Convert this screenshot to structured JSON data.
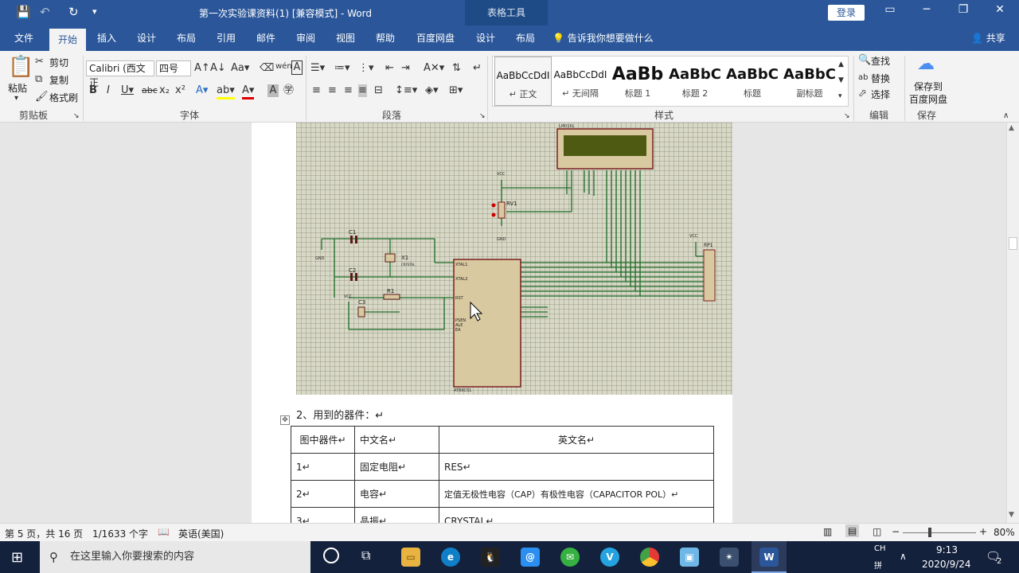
{
  "titlebar": {
    "doc_title": "第一次实验课资料(1) [兼容模式]  -  Word",
    "context_tool": "表格工具",
    "login_label": "登录"
  },
  "tabs": [
    "文件",
    "开始",
    "插入",
    "设计",
    "布局",
    "引用",
    "邮件",
    "审阅",
    "视图",
    "帮助",
    "百度网盘",
    "设计",
    "布局"
  ],
  "tell_me": "告诉我你想要做什么",
  "share_label": "共享",
  "ribbon": {
    "clipboard": {
      "paste": "粘贴",
      "cut": "剪切",
      "copy": "复制",
      "format_painter": "格式刷",
      "group": "剪贴板"
    },
    "font": {
      "name": "Calibri (西文正",
      "size": "四号",
      "group": "字体"
    },
    "paragraph": {
      "group": "段落"
    },
    "styles": {
      "group": "样式",
      "items": [
        {
          "sample": "AaBbCcDdI",
          "name": "↵ 正文"
        },
        {
          "sample": "AaBbCcDdI",
          "name": "↵ 无间隔"
        },
        {
          "sample": "AaBb",
          "name": "标题 1"
        },
        {
          "sample": "AaBbC",
          "name": "标题 2"
        },
        {
          "sample": "AaBbC",
          "name": "标题"
        },
        {
          "sample": "AaBbC",
          "name": "副标题"
        }
      ]
    },
    "editing": {
      "find": "查找",
      "replace": "替换",
      "select": "选择",
      "group": "编辑"
    },
    "save": {
      "label1": "保存到",
      "label2": "百度网盘",
      "group": "保存"
    }
  },
  "document": {
    "schematic": {
      "labels": {
        "lcd": "LM016L",
        "rv1": "RV1",
        "c1": "C1",
        "c2": "C2",
        "c3": "C3",
        "x1": "X1",
        "crystal": "CRYSTAL",
        "r1": "R1",
        "rp1": "RP1",
        "vcc": "VCC",
        "gnd": "GND",
        "mcu": "AT89C51",
        "xtal1": "XTAL1",
        "xtal2": "XTAL2",
        "rst": "RST",
        "psen": "PSEN",
        "ale": "ALE",
        "ea": "EA"
      }
    },
    "heading": "2、用到的器件：↵",
    "table": {
      "headers": [
        "图中器件↵",
        "中文名↵",
        "英文名↵"
      ],
      "rows": [
        [
          "1↵",
          "固定电阻↵",
          "RES↵"
        ],
        [
          "2↵",
          "电容↵",
          "定值无极性电容（CAP）有极性电容（CAPACITOR POL）↵"
        ],
        [
          "3↵",
          "晶振↵",
          "CRYSTAL↵"
        ]
      ]
    }
  },
  "status": {
    "page": "第 5 页，共 16 页",
    "words": "1/1633 个字",
    "lang": "英语(美国)",
    "zoom": "80%"
  },
  "taskbar": {
    "search_placeholder": "在这里输入你要搜索的内容",
    "ime": "CH",
    "ime2": "拼",
    "time": "9:13",
    "date": "2020/9/24",
    "notifications": "2"
  }
}
